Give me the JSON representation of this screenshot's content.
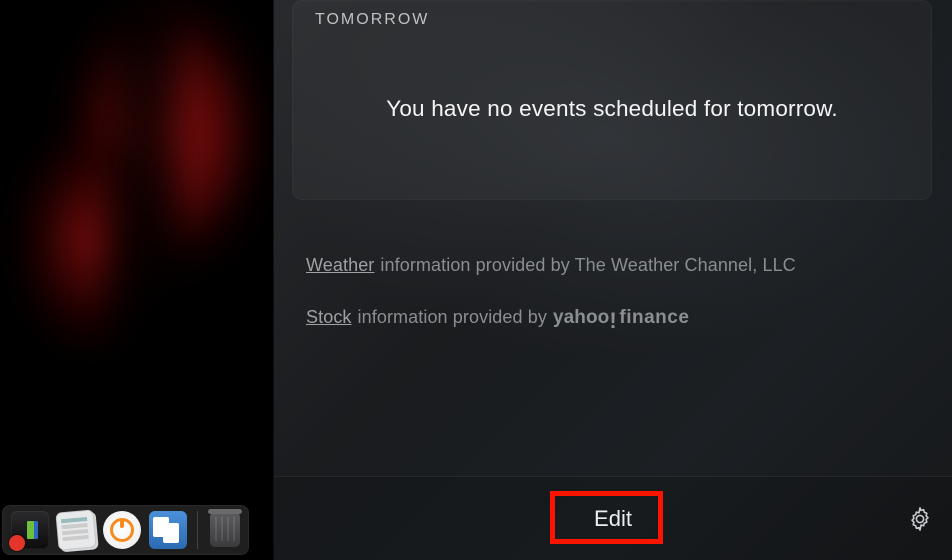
{
  "widget": {
    "header": "TOMORROW",
    "message": "You have no events scheduled for tomorrow."
  },
  "attribution": {
    "weather_link": "Weather",
    "weather_text": "information provided by The Weather Channel, LLC",
    "stock_link": "Stock",
    "stock_text": "information provided by",
    "yahoo_a": "yahoo",
    "yahoo_bang": "!",
    "yahoo_b": "finance"
  },
  "footer": {
    "edit_label": "Edit"
  },
  "dock": {
    "items": [
      "activity-monitor",
      "news-stack",
      "openvpn",
      "migration-assistant"
    ],
    "trash": "trash"
  }
}
